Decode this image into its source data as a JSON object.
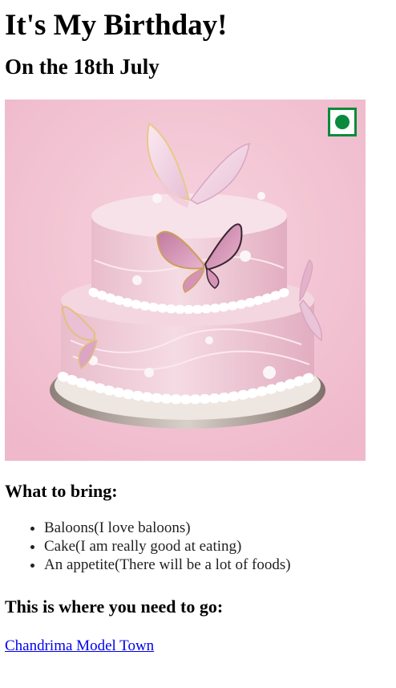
{
  "heading": "It's My Birthday!",
  "date": "On the 18th July",
  "image": {
    "subject": "two-tier pink butterfly cake",
    "badge": "veg-mark-icon",
    "colors": {
      "background": "#f3c3d1",
      "frosting": "#f0d1dc",
      "board": "#9a8f86",
      "veg_green": "#0a8a3c"
    }
  },
  "bring": {
    "heading": "What to bring:",
    "items": [
      "Baloons(I love baloons)",
      "Cake(I am really good at eating)",
      "An appetite(There will be a lot of foods)"
    ]
  },
  "location": {
    "heading": "This is where you need to go:",
    "link_text": "Chandrima Model Town",
    "link_color": "#0000ee"
  }
}
